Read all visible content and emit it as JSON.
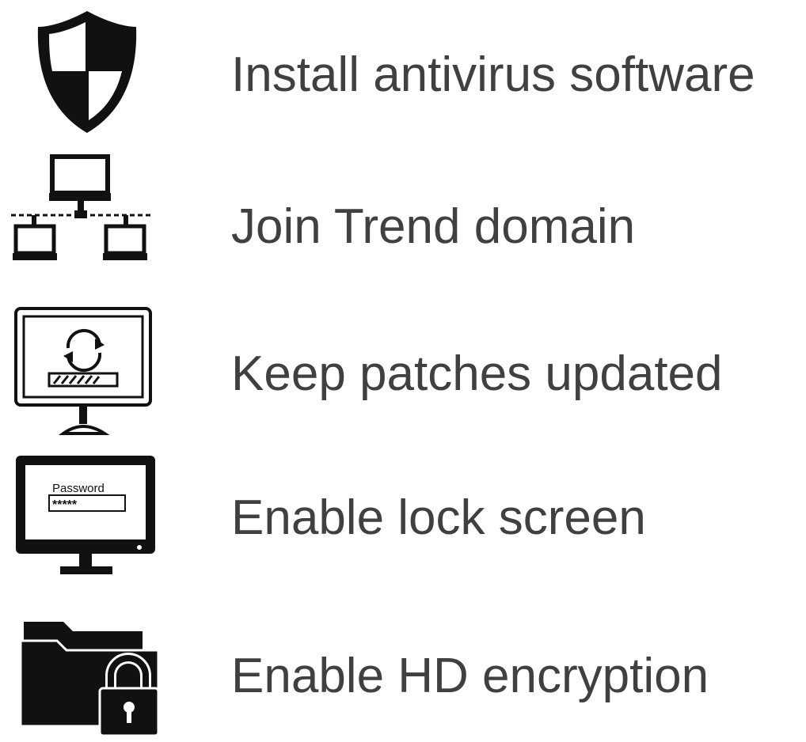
{
  "items": [
    {
      "icon": "shield-icon",
      "label": "Install antivirus software"
    },
    {
      "icon": "network-icon",
      "label": "Join Trend domain"
    },
    {
      "icon": "monitor-update-icon",
      "label": "Keep patches updated"
    },
    {
      "icon": "monitor-password-icon",
      "label": "Enable lock screen",
      "icon_text": "Password",
      "icon_mask": "*****"
    },
    {
      "icon": "folder-lock-icon",
      "label": "Enable HD encryption"
    }
  ]
}
